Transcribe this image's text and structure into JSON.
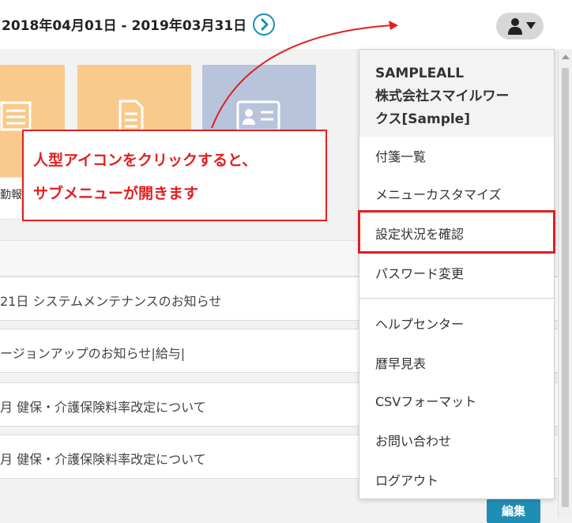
{
  "header": {
    "period": "2018年04月01日 - 2019年03月31日",
    "next_icon": "chevron-right-circle-icon",
    "user_icon": "person-icon",
    "user_caret_icon": "caret-down-icon"
  },
  "tiles": {
    "label": "勤報",
    "icons": [
      "form-icon",
      "document-icon",
      "id-card-icon"
    ]
  },
  "news": [
    "21日 システムメンテナンスのお知らせ",
    "ージョンアップのお知らせ|給与|",
    "月 健保・介護保険料率改定について",
    "月 健保・介護保険料率改定について"
  ],
  "edit_button": "編集",
  "menu": {
    "company_lines": [
      "SAMPLEALL",
      "株式会社スマイルワー",
      "クス[Sample]"
    ],
    "items": [
      "付箋一覧",
      "メニューカスタマイズ",
      "設定状況を確認",
      "パスワード変更",
      "ヘルプセンター",
      "暦早見表",
      "CSVフォーマット",
      "お問い合わせ",
      "ログアウト"
    ]
  },
  "callout": {
    "line1": "人型アイコンをクリックすると、",
    "line2": "サブメニューが開きます"
  },
  "colors": {
    "accent": "#1a8fb8",
    "annotation": "#e02020",
    "tile_orange": "#f9ca8c",
    "tile_blue": "#b8c3dc"
  }
}
